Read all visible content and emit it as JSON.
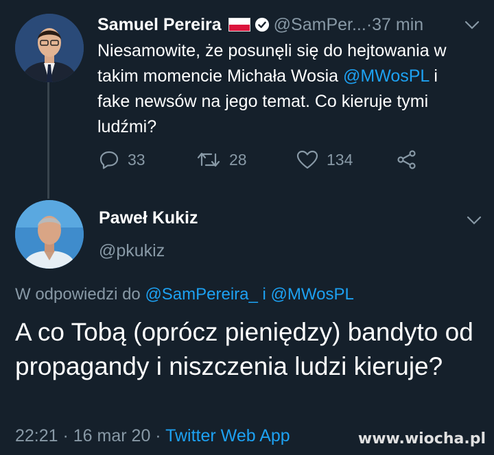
{
  "tweet1": {
    "name": "Samuel Pereira",
    "handle": "@SamPer...",
    "separator": " · ",
    "time": "37 min",
    "text_before": "Niesamowite, że posunęli się do hejtowania w takim momencie Michała Wosia ",
    "mention": "@MWosPL",
    "text_after": " i fake newsów na jego temat. Co kieruje tymi ludźmi?",
    "stats": {
      "replies": "33",
      "retweets": "28",
      "likes": "134"
    }
  },
  "tweet2": {
    "name": "Paweł Kukiz",
    "handle": "@pkukiz",
    "reply_prefix": "W odpowiedzi do ",
    "reply_mention1": "@SamPereira_",
    "reply_and": " i ",
    "reply_mention2": "@MWosPL",
    "text": "A co Tobą (oprócz pieniędzy) bandyto od propagandy i niszczenia ludzi kieruje?",
    "time": "22:21",
    "dot": " · ",
    "date": "16 mar 20",
    "source": "Twitter Web App"
  },
  "watermark": "www.wiocha.pl",
  "colors": {
    "background": "#15202b",
    "accent": "#1da1f2",
    "muted": "#8899a6",
    "flag_red": "#dc143c"
  }
}
